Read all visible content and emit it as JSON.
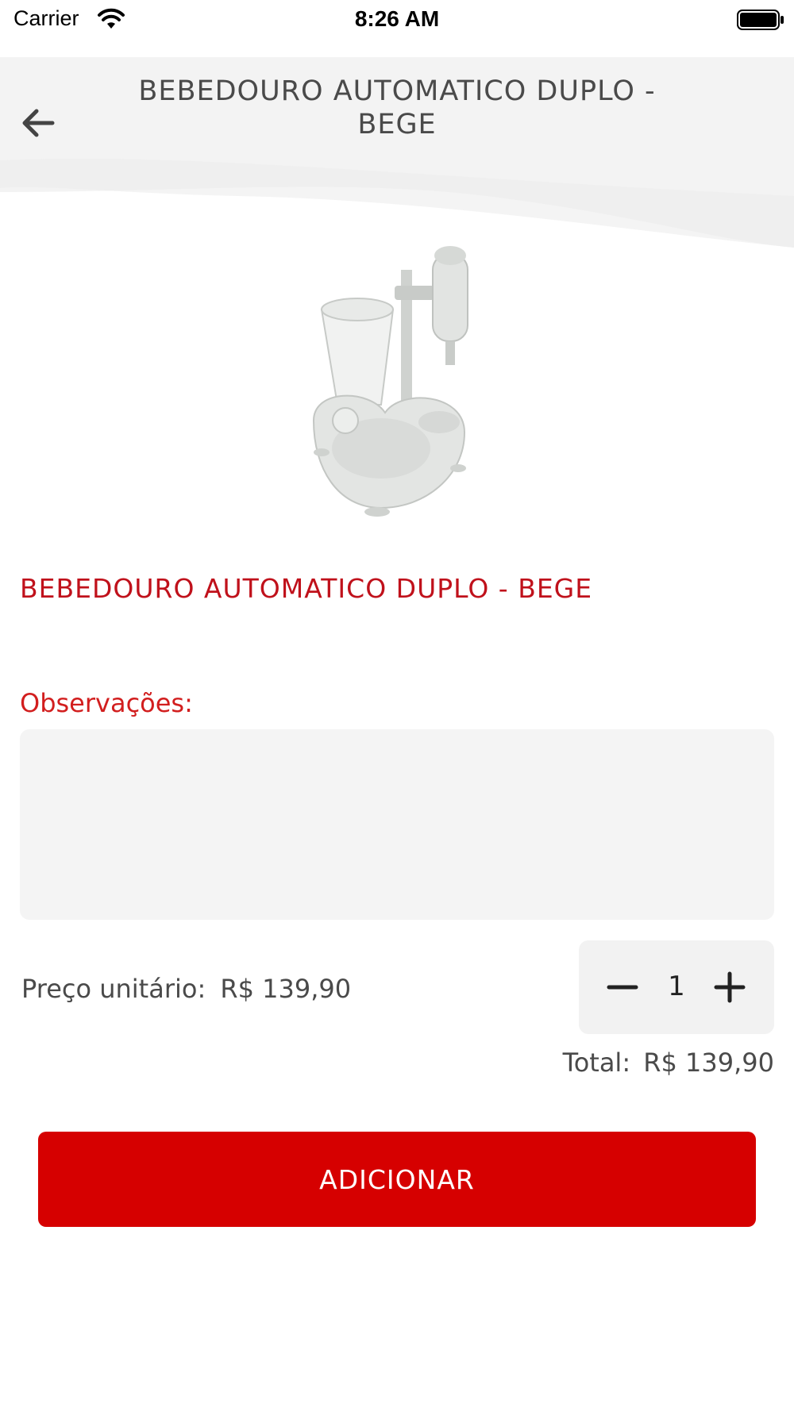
{
  "status_bar": {
    "carrier": "Carrier",
    "time": "8:26 AM"
  },
  "header": {
    "title": "BEBEDOURO AUTOMATICO DUPLO - BEGE",
    "back_icon": "arrow-left-icon"
  },
  "product": {
    "name": "BEBEDOURO AUTOMATICO DUPLO - BEGE",
    "image": "automatic-pet-water-fountain"
  },
  "notes": {
    "label": "Observações:",
    "value": "",
    "placeholder": ""
  },
  "pricing": {
    "unit_label": "Preço unitário:",
    "unit_price": "R$ 139,90",
    "total_label": "Total:",
    "total_price": "R$ 139,90"
  },
  "quantity": {
    "value": "1",
    "minus_icon": "minus-icon",
    "plus_icon": "plus-icon"
  },
  "actions": {
    "add_label": "ADICIONAR"
  },
  "colors": {
    "accent": "#d60000",
    "title_red": "#c0111b",
    "field_bg": "#f4f4f4"
  }
}
